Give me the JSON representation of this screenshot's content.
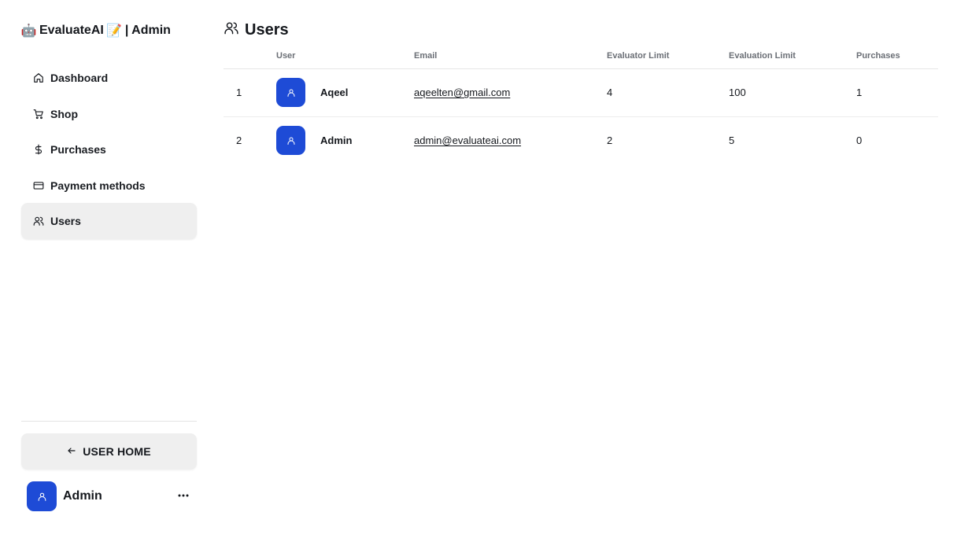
{
  "brand": {
    "title": "EvaluateAI",
    "suffix": "| Admin",
    "robot_emoji": "🤖",
    "memo_emoji": "📝"
  },
  "sidebar": {
    "items": [
      {
        "label": "Dashboard",
        "icon": "home-icon",
        "active": false
      },
      {
        "label": "Shop",
        "icon": "cart-icon",
        "active": false
      },
      {
        "label": "Purchases",
        "icon": "dollar-icon",
        "active": false
      },
      {
        "label": "Payment methods",
        "icon": "credit-card-icon",
        "active": false
      },
      {
        "label": "Users",
        "icon": "users-icon",
        "active": true
      }
    ],
    "home_button": "USER HOME",
    "profile_name": "Admin"
  },
  "main": {
    "title": "Users",
    "table": {
      "headers": [
        "",
        "User",
        "Email",
        "Evaluator Limit",
        "Evaluation Limit",
        "Purchases"
      ],
      "rows": [
        {
          "index": "1",
          "name": "Aqeel",
          "email": "aqeelten@gmail.com",
          "evaluator_limit": "4",
          "evaluation_limit": "100",
          "purchases": "1"
        },
        {
          "index": "2",
          "name": "Admin",
          "email": "admin@evaluateai.com",
          "evaluator_limit": "2",
          "evaluation_limit": "5",
          "purchases": "0"
        }
      ]
    }
  },
  "colors": {
    "accent": "#1e4bd6",
    "active_bg": "#efefef",
    "header_text": "#6b6f76"
  }
}
